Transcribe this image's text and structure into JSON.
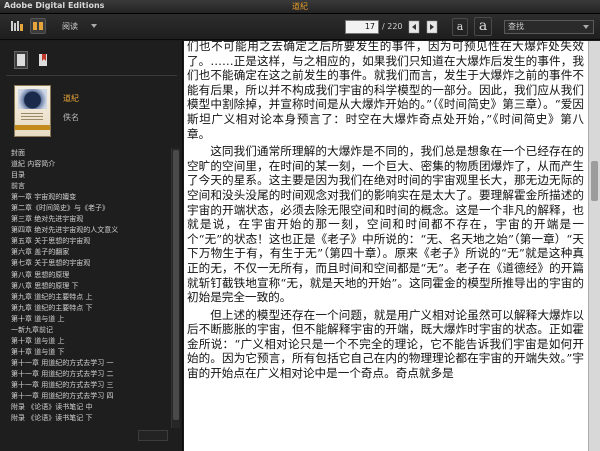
{
  "app": {
    "name": "Adobe Digital Editions",
    "doc_title": "道紀"
  },
  "toolbar": {
    "reading_label": "阅读",
    "current_page": "17",
    "total_pages": "/ 220",
    "font_small": "a",
    "font_large": "a",
    "search_value": "查找"
  },
  "sidebar": {
    "book_title": "道紀",
    "book_author": "佚名",
    "toc": [
      "封面",
      "道紀 内容简介",
      "目录",
      "前言",
      "第一章 宇宙观的嬗变",
      "第二章《时间简史》与《老子》",
      "第三章 绝对先进宇宙观",
      "第四章 绝对先进宇宙观的人文意义",
      "第五章 关于思想的宇宙观",
      "第六章 盖子的翻家",
      "第七章 关于思想的宇宙观",
      "第八章 思想的原理",
      "第八章 思想的原理 下",
      "第九章 道纪的主要特点 上",
      "第九章 道纪的主要特点 下",
      "第十章 道与道 上",
      "一新九章前记",
      "第十章 道与道 上",
      "第十章 道与道 下",
      "第十一章 用道纪的方式去学习 一",
      "第十一章 用道纪的方式去学习 二",
      "第十一章 用道纪的方式去学习 三",
      "第十一章 用道纪的方式去学习 四",
      "附录 《论语》读书笔记 中",
      "附录 《论语》读书笔记 下"
    ]
  },
  "content": {
    "paragraphs": [
      "们也不可能用之去确定之后所要发生的事件，因为可预见性在大爆炸处失效了。……正是这样，与之相应的，如果我们只知道在大爆炸后发生的事件，我们也不能确定在这之前发生的事件。就我们而言，发生于大爆炸之前的事件不能有后果，所以并不构成我们宇宙的科学模型的一部分。因此，我们应从我们模型中割除掉，并宣称时间是从大爆炸开始的。”（《时间简史》第三章）。“爱因斯坦广义相对论本身预言了：时空在大爆炸奇点处开始，”《时间简史》第八章。",
      "这同我们通常所理解的大爆炸是不同的，我们总是想象在一个已经存在的空旷的空间里，在时间的某一刻，一个巨大、密集的物质团爆炸了，从而产生了今天的星系。这主要是因为我们在绝对时间的宇宙观里长大，那无边无际的空间和没头没尾的时间观念对我们的影响实在是太大了。要理解霍金所描述的宇宙的开端状态，必须去除无限空间和时间的概念。这是一个非凡的解释，也就是说，在宇宙开始的那一刻，空间和时间都不存在，宇宙的开端是一个“无”的状态！这也正是《老子》中所说的：“无、名天地之始”（第一章）“天下万物生于有，有生于无”（第四十章）。原来《老子》所说的“无”就是这种真正的无，不仅一无所有，而且时间和空间都是“无”。老子在《道德经》的开篇就斩钉截铁地宣称“无，就是天地的开始”。这同霍金的模型所推导出的宇宙的初始是完全一致的。",
      "但上述的模型还存在一个问题，就是用广义相对论虽然可以解释大爆炸以后不断膨胀的宇宙，但不能解释宇宙的开端，既大爆炸时宇宙的状态。正如霍金所说：“广义相对论只是一个不完全的理论，它不能告诉我们宇宙是如何开始的。因为它预言，所有包括它自己在内的物理理论都在宇宙的开端失效。”宇宙的开始点在广义相对论中是一个奇点。奇点就多是"
    ]
  },
  "colors": {
    "accent": "#e6a53a",
    "title_accent": "#e09a2c",
    "page_bg": "#ffffff",
    "chrome_bg": "#1e1e1e"
  },
  "icons": {
    "library": "library-icon",
    "reading": "reading-view-icon",
    "prev": "previous-page-icon",
    "next": "next-page-icon",
    "tab1": "thumbnail-tab-icon",
    "tab2": "bookmark-tab-icon"
  }
}
